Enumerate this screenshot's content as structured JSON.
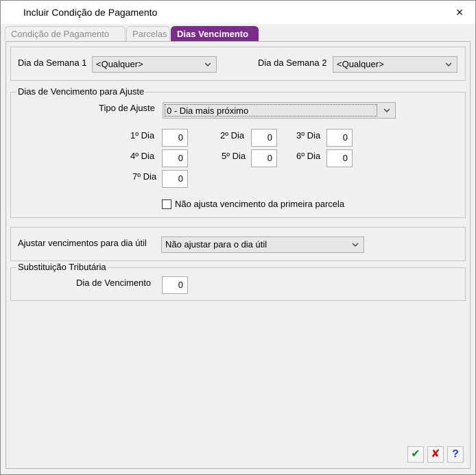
{
  "window": {
    "title": "Incluir Condição de Pagamento",
    "close_icon": "×"
  },
  "tabs": [
    {
      "label": "Condição de Pagamento"
    },
    {
      "label": "Parcelas"
    },
    {
      "label": "Dias Vencimento"
    }
  ],
  "weekdays": {
    "day1_label": "Dia da Semana 1",
    "day1_value": "<Qualquer>",
    "day2_label": "Dia da Semana 2",
    "day2_value": "<Qualquer>"
  },
  "adjust_group": {
    "title": "Dias de Vencimento para Ajuste",
    "type_label": "Tipo de Ajuste",
    "type_value": "0 - Dia mais próximo",
    "days": [
      {
        "label": "1º Dia",
        "value": "0"
      },
      {
        "label": "2º Dia",
        "value": "0"
      },
      {
        "label": "3º Dia",
        "value": "0"
      },
      {
        "label": "4º Dia",
        "value": "0"
      },
      {
        "label": "5º Dia",
        "value": "0"
      },
      {
        "label": "6º Dia",
        "value": "0"
      },
      {
        "label": "7º Dia",
        "value": "0"
      }
    ],
    "checkbox_label": "Não ajusta vencimento da primeira parcela"
  },
  "business_day": {
    "label": "Ajustar vencimentos para dia útil",
    "value": "Não ajustar para o dia útil"
  },
  "tax_group": {
    "title": "Substituição Tributária",
    "due_label": "Dia de Vencimento",
    "due_value": "0"
  },
  "footer": {
    "confirm_icon": "✔",
    "cancel_icon": "✘",
    "help_icon": "?",
    "colors": {
      "confirm": "#1e8c1e",
      "cancel": "#d01010",
      "help": "#1a3fbf",
      "active_tab": "#7b2d8b"
    }
  }
}
